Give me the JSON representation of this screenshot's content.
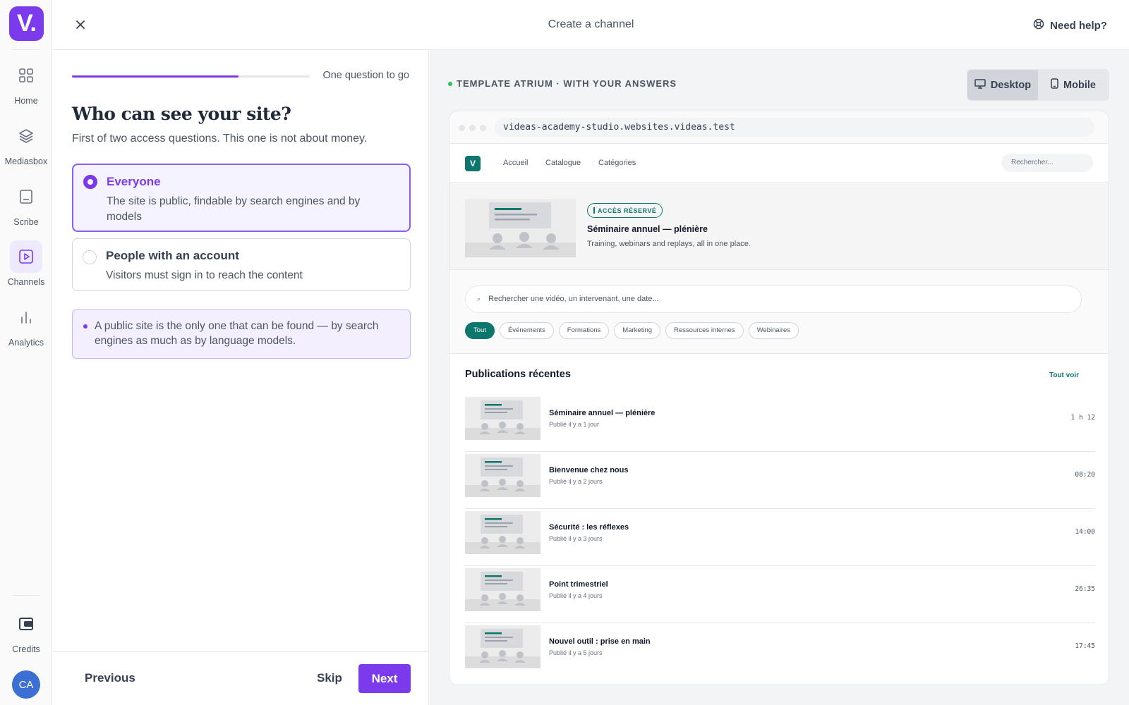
{
  "sidebar": {
    "logo": "V.",
    "items": [
      {
        "label": "Home",
        "icon": "grid-icon"
      },
      {
        "label": "Mediasbox",
        "icon": "layers-icon"
      },
      {
        "label": "Scribe",
        "icon": "document-icon"
      },
      {
        "label": "Channels",
        "icon": "play-square-icon",
        "active": true
      },
      {
        "label": "Analytics",
        "icon": "bar-chart-icon"
      }
    ],
    "credits_label": "Credits",
    "avatar_initials": "CA"
  },
  "topbar": {
    "title": "Create a channel",
    "help_label": "Need help?"
  },
  "form": {
    "progress": 0.7,
    "progress_text": "One question to go",
    "question": "Who can see your site?",
    "subtitle": "First of two access questions. This one is not about money.",
    "options": [
      {
        "title": "Everyone",
        "description": "The site is public, findable by search engines and by models",
        "selected": true
      },
      {
        "title": "People with an account",
        "description": "Visitors must sign in to reach the content",
        "selected": false
      }
    ],
    "note": "A public site is the only one that can be found — by search engines as much as by language models.",
    "previous_label": "Previous",
    "skip_label": "Skip",
    "next_label": "Next"
  },
  "preview": {
    "template_label": "TEMPLATE ATRIUM · WITH YOUR ANSWERS",
    "view_modes": [
      {
        "label": "Desktop",
        "active": true
      },
      {
        "label": "Mobile",
        "active": false
      }
    ],
    "url": "videas-academy-studio.websites.videas.test",
    "site": {
      "logo": "V",
      "nav_links": [
        "Accueil",
        "Catalogue",
        "Catégories"
      ],
      "search_placeholder": "Rechercher...",
      "hero": {
        "badge": "ACCÈS RÉSERVÉ",
        "title": "Séminaire annuel — plénière",
        "subtitle": "Training, webinars and replays, all in one place."
      },
      "main_search_placeholder": "Rechercher une vidéo, un intervenant, une date...",
      "chips": [
        "Tout",
        "Événements",
        "Formations",
        "Marketing",
        "Ressources internes",
        "Webinaires"
      ],
      "recent_heading": "Publications récentes",
      "see_all_label": "Tout voir",
      "videos": [
        {
          "title": "Séminaire annuel — plénière",
          "date": "Publié il y a 1 jour",
          "duration": "1 h 12"
        },
        {
          "title": "Bienvenue chez nous",
          "date": "Publié il y a 2 jours",
          "duration": "08:20"
        },
        {
          "title": "Sécurité : les réflexes",
          "date": "Publié il y a 3 jours",
          "duration": "14:00"
        },
        {
          "title": "Point trimestriel",
          "date": "Publié il y a 4 jours",
          "duration": "26:35"
        },
        {
          "title": "Nouvel outil : prise en main",
          "date": "Publié il y a 5 jours",
          "duration": "17:45"
        }
      ]
    }
  },
  "colors": {
    "accent": "#7c3aed",
    "site_accent": "#0f766e",
    "avatar": "#3b6fd4"
  }
}
